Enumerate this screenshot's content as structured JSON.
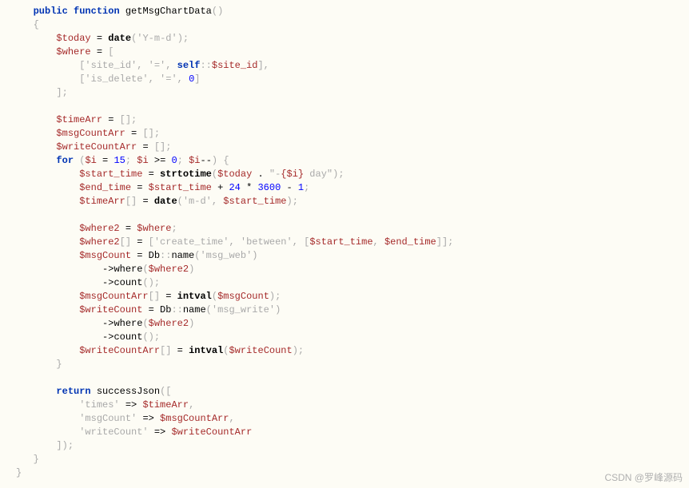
{
  "code": {
    "l1": {
      "kw1": "public",
      "kw2": "function",
      "fn": "getMsgChartData"
    },
    "l4": {
      "var": "$today",
      "fn": "date",
      "str": "'Y-m-d'"
    },
    "l5": {
      "var": "$where"
    },
    "l6": {
      "str1": "'site_id'",
      "str2": "'='",
      "kw": "self",
      "var": "$site_id"
    },
    "l7": {
      "str1": "'is_delete'",
      "str2": "'='",
      "num": "0"
    },
    "l10": {
      "var": "$timeArr"
    },
    "l11": {
      "var": "$msgCountArr"
    },
    "l12": {
      "var": "$writeCountArr"
    },
    "l13": {
      "kw": "for",
      "var": "$i",
      "num1": "15",
      "num2": "0"
    },
    "l14": {
      "var": "$start_time",
      "fn": "strtotime",
      "var2": "$today",
      "str1": "\"-",
      "str2": " day\"",
      "var3": "{$i}"
    },
    "l15": {
      "var": "$end_time",
      "var2": "$start_time",
      "num1": "24",
      "num2": "3600",
      "num3": "1"
    },
    "l16": {
      "var": "$timeArr",
      "fn": "date",
      "str": "'m-d'",
      "var2": "$start_time"
    },
    "l18": {
      "var": "$where2",
      "var2": "$where"
    },
    "l19": {
      "var": "$where2",
      "str1": "'create_time'",
      "str2": "'between'",
      "var2": "$start_time",
      "var3": "$end_time"
    },
    "l20": {
      "var": "$msgCount",
      "cls": "Db",
      "fn": "name",
      "str": "'msg_web'"
    },
    "l21": {
      "fn": "where",
      "var": "$where2"
    },
    "l22": {
      "fn": "count"
    },
    "l23": {
      "var": "$msgCountArr",
      "fn": "intval",
      "var2": "$msgCount"
    },
    "l24": {
      "var": "$writeCount",
      "cls": "Db",
      "fn": "name",
      "str": "'msg_write'"
    },
    "l25": {
      "fn": "where",
      "var": "$where2"
    },
    "l26": {
      "fn": "count"
    },
    "l27": {
      "var": "$writeCountArr",
      "fn": "intval",
      "var2": "$writeCount"
    },
    "l30": {
      "kw": "return",
      "fn": "successJson"
    },
    "l31": {
      "str": "'times'",
      "var": "$timeArr"
    },
    "l32": {
      "str": "'msgCount'",
      "var": "$msgCountArr"
    },
    "l33": {
      "str": "'writeCount'",
      "var": "$writeCountArr"
    }
  },
  "watermark": "CSDN @罗峰源码"
}
